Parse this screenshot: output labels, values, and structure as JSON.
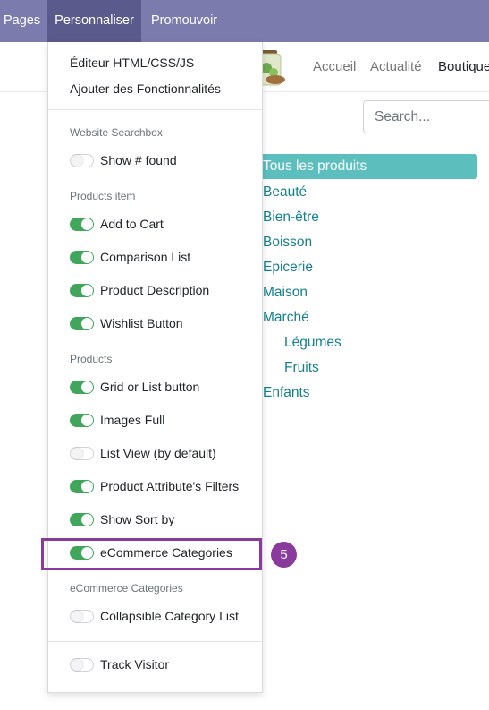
{
  "topbar": {
    "menus": [
      "Pages",
      "Personnaliser",
      "Promouvoir"
    ]
  },
  "site_nav": {
    "links": [
      "Accueil",
      "Actualité",
      "Boutique"
    ]
  },
  "search": {
    "placeholder": "Search..."
  },
  "categories": {
    "active": "Tous les produits",
    "items": [
      "Beauté",
      "Bien-être",
      "Boisson",
      "Epicerie",
      "Maison",
      "Marché",
      "Légumes",
      "Fruits",
      "Enfants"
    ]
  },
  "customize_menu": {
    "links": [
      "Éditeur HTML/CSS/JS",
      "Ajouter des Fonctionnalités"
    ],
    "sections": [
      {
        "heading": "Website Searchbox",
        "options": [
          {
            "label": "Show # found",
            "checked": false
          }
        ]
      },
      {
        "heading": "Products item",
        "options": [
          {
            "label": "Add to Cart",
            "checked": true
          },
          {
            "label": "Comparison List",
            "checked": true
          },
          {
            "label": "Product Description",
            "checked": true
          },
          {
            "label": "Wishlist Button",
            "checked": true
          }
        ]
      },
      {
        "heading": "Products",
        "options": [
          {
            "label": "Grid or List button",
            "checked": true
          },
          {
            "label": "Images Full",
            "checked": true
          },
          {
            "label": "List View (by default)",
            "checked": false
          },
          {
            "label": "Product Attribute's Filters",
            "checked": true
          },
          {
            "label": "Show Sort by",
            "checked": true
          },
          {
            "label": "eCommerce Categories",
            "checked": true
          }
        ]
      },
      {
        "heading": "eCommerce Categories",
        "options": [
          {
            "label": "Collapsible Category List",
            "checked": false
          }
        ]
      }
    ],
    "footer_option": {
      "label": "Track Visitor",
      "checked": false
    }
  },
  "annotation": {
    "step": "5",
    "color": "#8a3a9c"
  },
  "colors": {
    "topbar": "#7c7bad",
    "toggle_on": "#3fa65b",
    "category_active": "#5cbfbe",
    "category_link": "#17808e"
  }
}
